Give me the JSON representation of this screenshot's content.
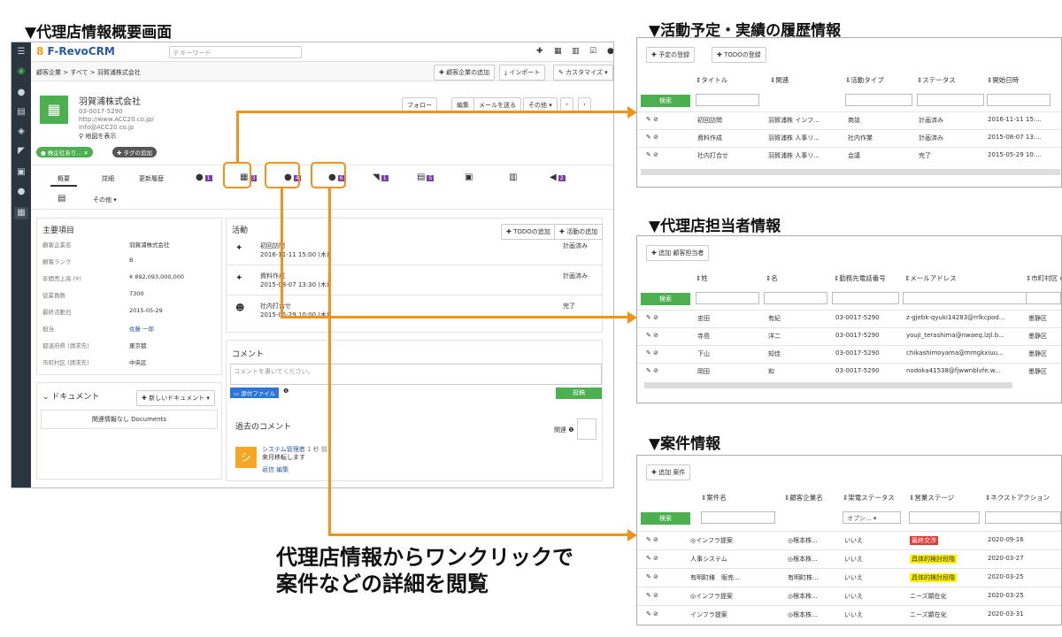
{
  "headings": {
    "main": "▼代理店情報概要画面",
    "activity": "▼活動予定・実績の履歴情報",
    "contact": "▼代理店担当者情報",
    "deal": "▼案件情報"
  },
  "caption": [
    "代理店情報からワンクリックで",
    "案件などの詳細を閲覧"
  ],
  "colors": {
    "accent": "#f29219",
    "purple_badge": "#7b3fa8",
    "green": "#4caf50",
    "sidebar": "#2b3540"
  },
  "crm": {
    "logo": "F-RevoCRM",
    "search_placeholder": "キーワード",
    "breadcrumb": "顧客企業 > すべて > 羽賀浦株式会社",
    "actions": {
      "add": "顧客企業の追加",
      "import": "インポート",
      "customize": "カスタマイズ"
    },
    "company": {
      "name": "羽賀浦株式会社",
      "phone": "03-0017-5290",
      "url": "http://www.ACC20.co.jp/",
      "email": "info@ACC20.co.jp",
      "map": "地図を表示",
      "tag": "株企社あり...",
      "tag_add": "タグの追加"
    },
    "header_buttons": {
      "follow": "フォロー",
      "edit": "編集",
      "send_mail": "メールを送る",
      "more": "その他"
    },
    "tabs": {
      "summary": "概要",
      "detail": "詳細",
      "history": "更新履歴",
      "more": "その他"
    },
    "badges": {
      "comments": "1",
      "calendar": "3",
      "contacts": "4",
      "deals": "6",
      "b5": "1",
      "b6": "5",
      "b9": "2"
    },
    "main_fields_title": "主要項目",
    "fields": [
      {
        "label": "顧客企業名",
        "value": "羽賀浦株式会社"
      },
      {
        "label": "顧客ランク",
        "value": "B"
      },
      {
        "label": "年間売上高 (¥)",
        "value": "¥ 892,093,000,000"
      },
      {
        "label": "従業員数",
        "value": "7300"
      },
      {
        "label": "最終活動日",
        "value": "2015-05-29"
      },
      {
        "label": "担当",
        "value": "佐藤 一郎"
      },
      {
        "label": "都道府県 (請求先)",
        "value": "東京都"
      },
      {
        "label": "市町村区 (請求先)",
        "value": "中央区"
      }
    ],
    "document": {
      "title": "ドキュメント",
      "new": "新しいドキュメント",
      "empty": "関連情報なし Documents"
    },
    "activity": {
      "title": "活動",
      "add_todo": "TODOの追加",
      "add_activity": "活動の追加",
      "items": [
        {
          "title": "初回訪問",
          "time": "2016-11-11 15:00 (木)",
          "status": "計画済み"
        },
        {
          "title": "資料作成",
          "time": "2015-08-07 13:30 (木)",
          "status": "計画済み"
        },
        {
          "title": "社内打合せ",
          "time": "2015-05-29 10:00 (木)",
          "status": "完了"
        }
      ]
    },
    "comment": {
      "title": "コメント",
      "placeholder": "コメントを書いてください。",
      "attach": "添付ファイル",
      "post": "投稿",
      "past_title": "過去のコメント",
      "related": "関連",
      "author": "システム管理者",
      "author_suffix": "1 秒 前",
      "text": "来月移転します",
      "reply": "返信",
      "edit": "編集",
      "avatar": "シ"
    }
  },
  "activity_table": {
    "buttons": [
      "予定の登録",
      "TODOの登録"
    ],
    "headers": [
      "タイトル",
      "関連",
      "活動タイプ",
      "ステータス",
      "開始日時"
    ],
    "search": "検索",
    "rows": [
      [
        "初回訪問",
        "羽賀浦株 インフ...",
        "商談",
        "計画済み",
        "2016-11-11 15:..."
      ],
      [
        "資料作成",
        "羽賀浦株 人事リ...",
        "社内作業",
        "計画済み",
        "2015-08-07 13:..."
      ],
      [
        "社内打合せ",
        "羽賀浦株 人事リ...",
        "会議",
        "完了",
        "2015-05-29 10:..."
      ]
    ]
  },
  "contact_table": {
    "button": "追加 顧客担当者",
    "headers": [
      "姓",
      "名",
      "勤務先電話番号",
      "メールアドレス",
      "市町村区 ("
    ],
    "search": "検索",
    "rows": [
      [
        "忠田",
        "有紀",
        "03-0017-5290",
        "z-gjebk-qyuki14283@rrlkcpod...",
        "墨静区"
      ],
      [
        "寺島",
        "洋二",
        "03-0017-5290",
        "youji_terashima@nwaeq.lzjl.b...",
        "墨静区"
      ],
      [
        "下山",
        "知佳",
        "03-0017-5290",
        "chikashimoyama@mmgkxiuu...",
        "墨静区"
      ],
      [
        "岡田",
        "和",
        "03-0017-5290",
        "nodoka41538@fjwwnblvfe.w...",
        "墨静区"
      ]
    ]
  },
  "deal_table": {
    "button": "追加 案件",
    "headers": [
      "案件名",
      "顧客企業名",
      "架電ステータス",
      "営業ステージ",
      "ネクストアクション"
    ],
    "search": "検索",
    "filter_select": "オプシ...",
    "rows": [
      {
        "name": "◎インフラ提案",
        "company": "◎根本株...",
        "call": "いいえ",
        "stage": "最終交渉",
        "stage_style": "red",
        "date": "2020-09-16"
      },
      {
        "name": "人事システム",
        "company": "◎根本株...",
        "call": "いいえ",
        "stage": "具体的検討段階",
        "stage_style": "yellow",
        "date": "2020-03-27"
      },
      {
        "name": "有明町様　販売...",
        "company": "有明町株...",
        "call": "いいえ",
        "stage": "具体的検討段階",
        "stage_style": "yellow",
        "date": "2020-03-25"
      },
      {
        "name": "◎インフラ提案",
        "company": "◎根本株...",
        "call": "いいえ",
        "stage": "ニーズ顕在化",
        "stage_style": "none",
        "date": "2020-03-25"
      },
      {
        "name": "インフラ提案",
        "company": "◎根本株...",
        "call": "いいえ",
        "stage": "ニーズ顕在化",
        "stage_style": "none",
        "date": "2020-03-31"
      }
    ]
  }
}
